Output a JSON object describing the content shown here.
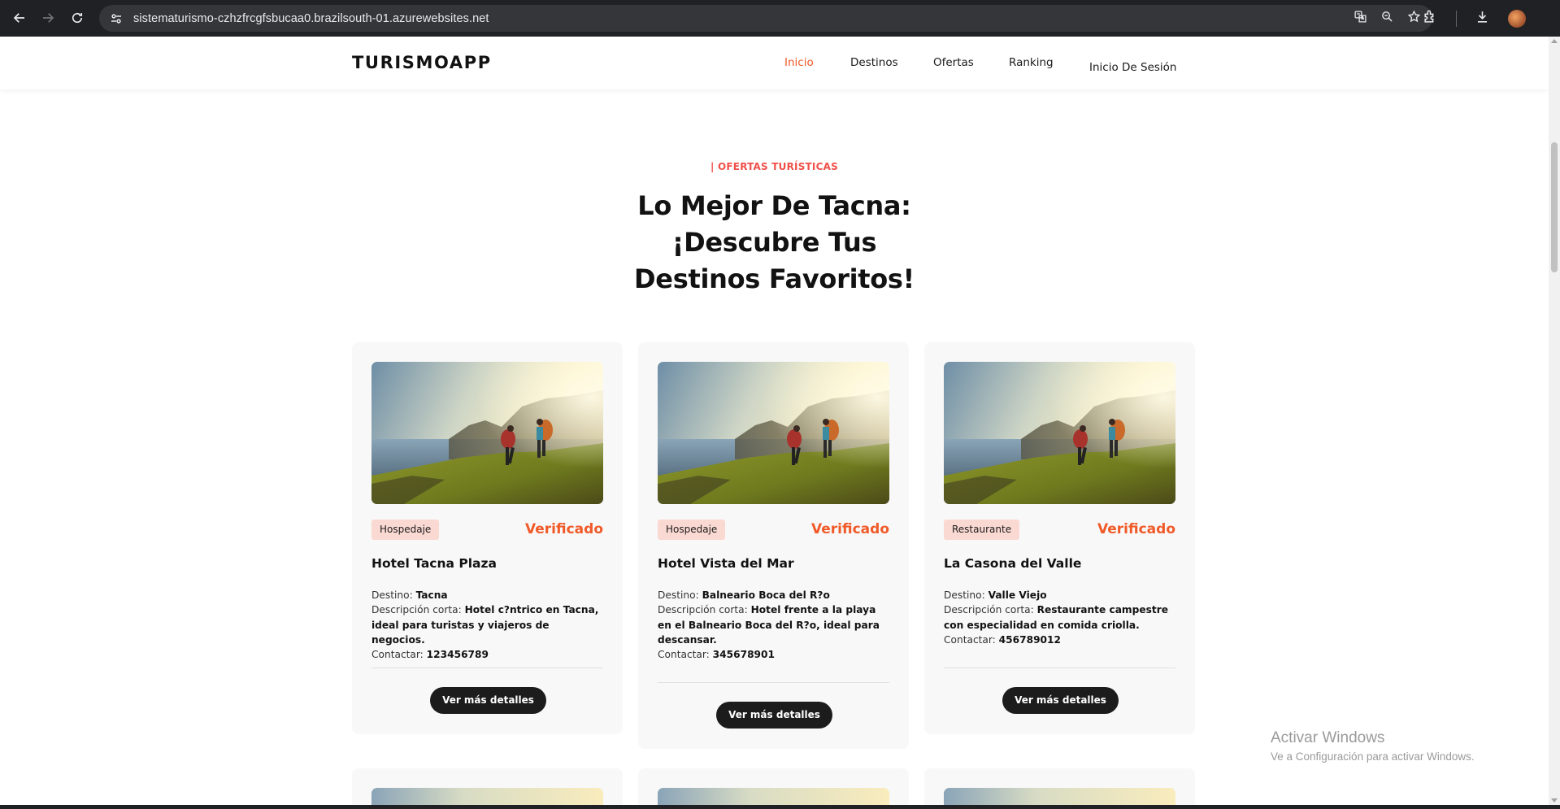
{
  "browser": {
    "url": "sistematurismo-czhzfrcgfsbucaa0.brazilsouth-01.azurewebsites.net",
    "icons": [
      "back-icon",
      "forward-icon",
      "reload-icon",
      "site-settings-icon",
      "translate-icon",
      "zoom-icon",
      "bookmark-star-icon",
      "extensions-icon",
      "downloads-icon",
      "profile-avatar"
    ]
  },
  "header": {
    "brand": "TURISMOAPP",
    "nav": [
      {
        "label": "Inicio",
        "active": true
      },
      {
        "label": "Destinos",
        "active": false
      },
      {
        "label": "Ofertas",
        "active": false
      },
      {
        "label": "Ranking",
        "active": false
      },
      {
        "label": "Inicio De Sesión",
        "active": false
      }
    ]
  },
  "section": {
    "kicker": "| OFERTAS TURÍSTICAS",
    "title_line1": "Lo Mejor De Tacna:",
    "title_line2": "¡Descubre Tus",
    "title_line3": "Destinos Favoritos!"
  },
  "cards": [
    {
      "category": "Hospedaje",
      "status": "Verificado",
      "name": "Hotel Tacna Plaza",
      "destino_label": "Destino:",
      "destino": "Tacna",
      "descripcion_label": "Descripción corta:",
      "descripcion": "Hotel c?ntrico en Tacna, ideal para turistas y viajeros de negocios.",
      "contacto_label": "Contactar:",
      "contacto": "123456789",
      "button": "Ver más detalles"
    },
    {
      "category": "Hospedaje",
      "status": "Verificado",
      "name": "Hotel Vista del Mar",
      "destino_label": "Destino:",
      "destino": "Balneario Boca del R?o",
      "descripcion_label": "Descripción corta:",
      "descripcion": "Hotel frente a la playa en el Balneario Boca del R?o, ideal para descansar.",
      "contacto_label": "Contactar:",
      "contacto": "345678901",
      "button": "Ver más detalles"
    },
    {
      "category": "Restaurante",
      "status": "Verificado",
      "name": "La Casona del Valle",
      "destino_label": "Destino:",
      "destino": "Valle Viejo",
      "descripcion_label": "Descripción corta:",
      "descripcion": "Restaurante campestre con especialidad en comida criolla.",
      "contacto_label": "Contactar:",
      "contacto": "456789012",
      "button": "Ver más detalles"
    }
  ],
  "watermark": {
    "line1": "Activar Windows",
    "line2": "Ve a Configuración para activar Windows."
  },
  "colors": {
    "accent": "#f05a28",
    "kicker": "#f0504a",
    "badge_bg": "#fbd9d3",
    "button_bg": "#1c1c1c",
    "card_bg": "#f8f8f8"
  }
}
